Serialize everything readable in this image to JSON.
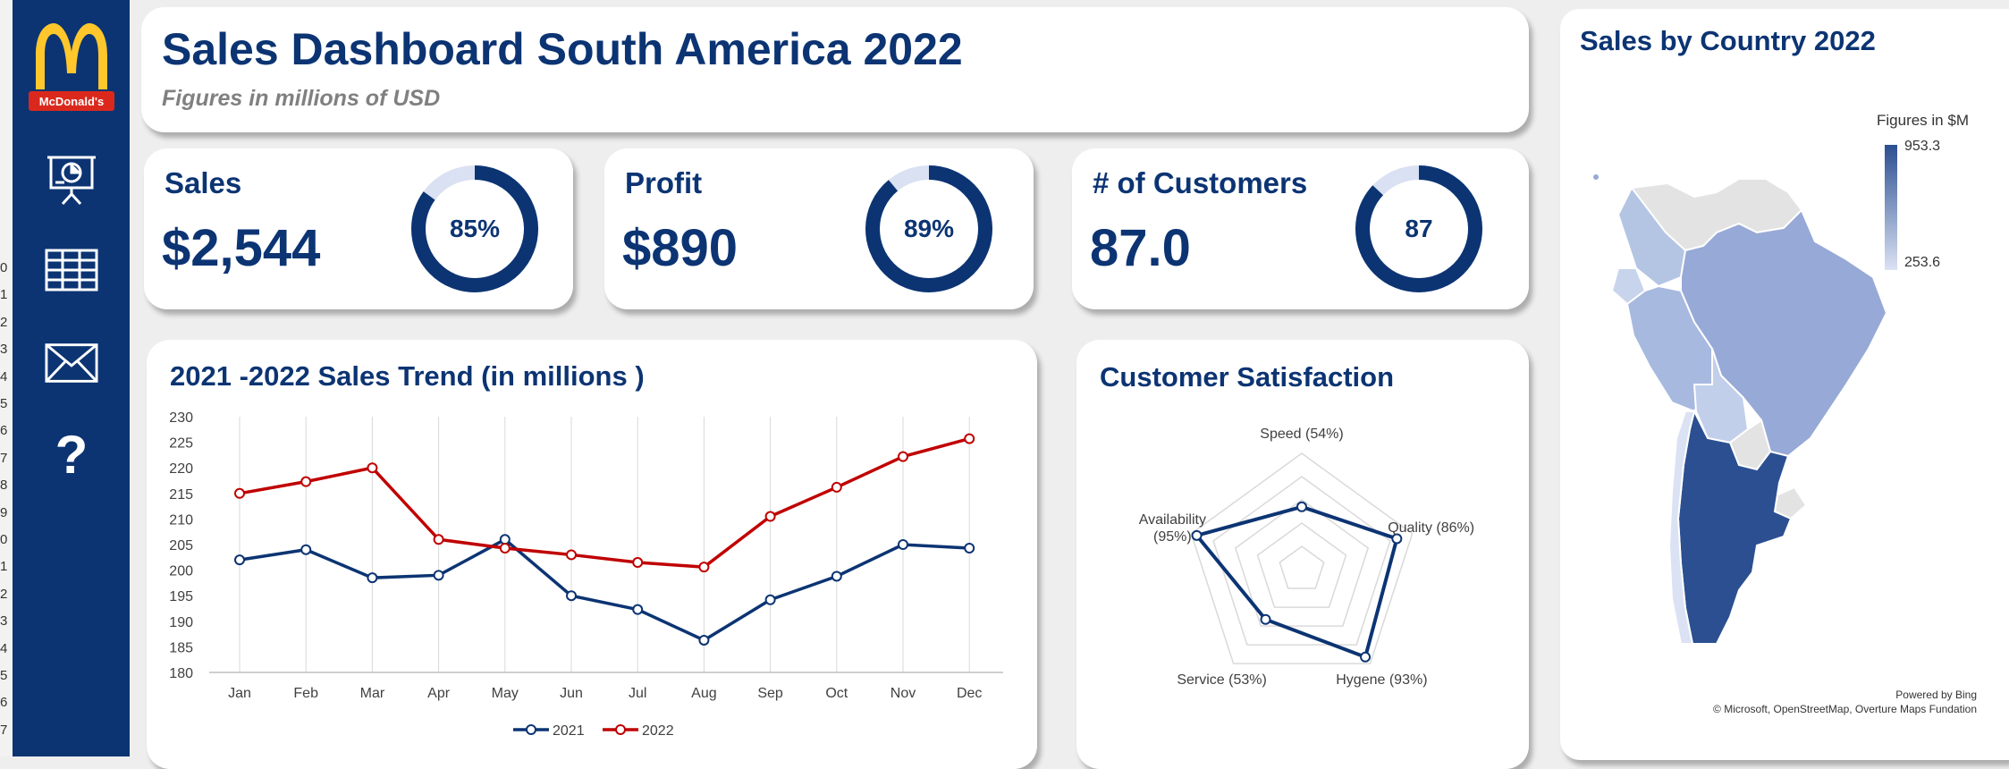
{
  "row_numbers": [
    "0",
    "1",
    "2",
    "3",
    "4",
    "5",
    "6",
    "7",
    "8",
    "9",
    "0",
    "1",
    "2",
    "3",
    "4",
    "5",
    "6",
    "7"
  ],
  "sidebar": {
    "brand": "McDonald's",
    "icons": [
      "mcdonalds-logo",
      "presentation-icon",
      "table-icon",
      "mail-icon",
      "help-icon"
    ],
    "help_glyph": "?"
  },
  "header": {
    "title": "Sales Dashboard South America 2022",
    "subtitle": "Figures in millions of USD"
  },
  "kpis": [
    {
      "label": "Sales",
      "value": "$2,544",
      "percent_text": "85%",
      "fill": 0.85
    },
    {
      "label": "Profit",
      "value": "$890",
      "percent_text": "89%",
      "fill": 0.89
    },
    {
      "label": "# of Customers",
      "value": "87.0",
      "percent_text": "87",
      "fill": 0.87
    }
  ],
  "colors": {
    "navy": "#0c3473",
    "red": "#c00000",
    "light_ring": "#d9e1f2"
  },
  "chart_data": [
    {
      "type": "line",
      "title": "2021 -2022 Sales Trend (in millions )",
      "categories": [
        "Jan",
        "Feb",
        "Mar",
        "Apr",
        "May",
        "Jun",
        "Jul",
        "Aug",
        "Sep",
        "Oct",
        "Nov",
        "Dec"
      ],
      "series": [
        {
          "name": "2021",
          "color": "#0c3473",
          "values": [
            202,
            204,
            198.5,
            199,
            206,
            195,
            192.3,
            186.3,
            194.2,
            198.8,
            205,
            204.3
          ]
        },
        {
          "name": "2022",
          "color": "#c00000",
          "values": [
            215,
            217.3,
            220,
            206,
            204.3,
            203,
            201.5,
            200.6,
            210.5,
            216.2,
            222.2,
            225.7
          ]
        }
      ],
      "ylim": [
        180,
        230
      ],
      "yticks": [
        "180",
        "185",
        "190",
        "195",
        "200",
        "205",
        "210",
        "215",
        "220",
        "225",
        "230"
      ],
      "legend": "bottom",
      "grid": "vertical"
    },
    {
      "type": "radar",
      "title": "Customer Satisfaction",
      "axes": [
        {
          "label": "Speed (54%)",
          "lines": [
            "Speed (54%)"
          ],
          "value": 54
        },
        {
          "label": "Quality (86%)",
          "lines": [
            "Quality (86%)"
          ],
          "value": 86
        },
        {
          "label": "Hygene (93%)",
          "lines": [
            "Hygene (93%)"
          ],
          "value": 93
        },
        {
          "label": "Service (53%)",
          "lines": [
            "Service (53%)"
          ],
          "value": 53
        },
        {
          "label": "Availability (95%)",
          "lines": [
            "Availability",
            "(95%)"
          ],
          "value": 95
        }
      ],
      "range": [
        0,
        100
      ]
    }
  ],
  "map": {
    "title": "Sales by Country 2022",
    "legend_title": "Figures in $M",
    "legend_max": "953.3",
    "legend_min": "253.6",
    "credit_line1": "Powered by Bing",
    "credit_line2": "© Microsoft, OpenStreetMap, Overture Maps Fundation"
  }
}
